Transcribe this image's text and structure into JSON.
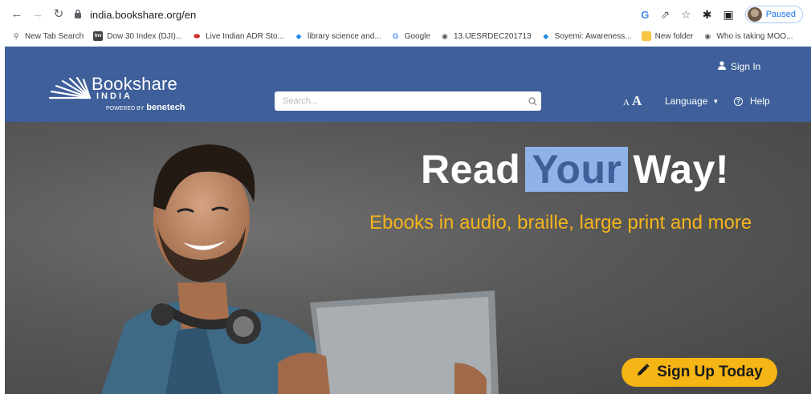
{
  "browser": {
    "url": "india.bookshare.org/en",
    "profile_status": "Paused"
  },
  "bookmarks": [
    {
      "label": "New Tab Search",
      "icon": "search-icon"
    },
    {
      "label": "Dow 30 Index (DJI)...",
      "icon": "investing-icon",
      "color": "#444444"
    },
    {
      "label": "Live Indian ADR Sto...",
      "icon": "red-pill-icon",
      "color": "#d32f2f"
    },
    {
      "label": "library science and...",
      "icon": "diamond-icon",
      "color": "#1e88e5"
    },
    {
      "label": "Google",
      "icon": "google-icon",
      "color": "#4285f4"
    },
    {
      "label": "13.IJESRDEC201713",
      "icon": "globe-icon",
      "color": "#555555"
    },
    {
      "label": "Soyemi: Awareness...",
      "icon": "diamond-icon",
      "color": "#1e88e5"
    },
    {
      "label": "New folder",
      "icon": "folder-icon",
      "color": "#f5c543"
    },
    {
      "label": "Who is taking MOO...",
      "icon": "globe-icon",
      "color": "#555555"
    }
  ],
  "header": {
    "logo_name": "Bookshare",
    "logo_country": "INDIA",
    "logo_powered_prefix": "POWERED BY",
    "logo_powered_brand": "benetech",
    "search_placeholder": "Search...",
    "sign_in": "Sign In",
    "text_size_small": "A",
    "text_size_large": "A",
    "language": "Language",
    "help": "Help",
    "brand_color": "#3e5f9a"
  },
  "hero": {
    "title_part1": "Read",
    "title_highlight": "Your",
    "title_part2": "Way!",
    "subtitle": "Ebooks in audio, braille, large print and more",
    "cta": "Sign Up Today",
    "cta_color": "#f5b515",
    "subtitle_color": "#f4b41a"
  }
}
